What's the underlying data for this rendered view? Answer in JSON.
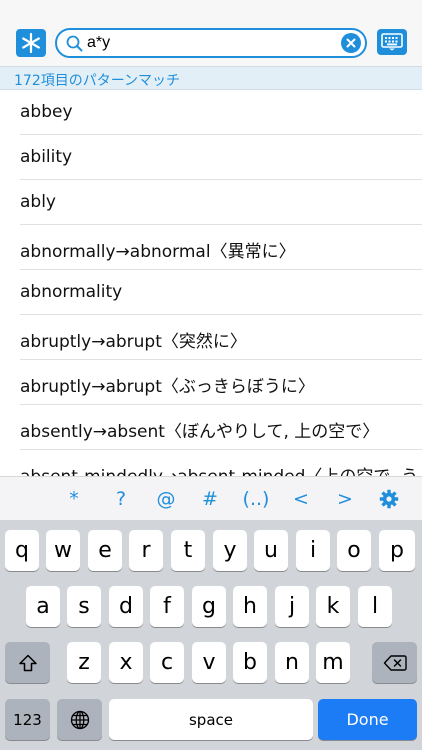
{
  "search": {
    "query": "a*y"
  },
  "match_count": "172項目のパターンマッチ",
  "results": [
    "abbey",
    "ability",
    "ably",
    "abnormally→abnormal〈異常に〉",
    "abnormality",
    "abruptly→abrupt〈突然に〉",
    "abruptly→abrupt〈ぶっきらぼうに〉",
    "absently→absent〈ぼんやりして, 上の空で〉",
    "absent-mindedly→absent-minded〈上の空で, う"
  ],
  "accessory_keys": [
    "*",
    "?",
    "@",
    "#",
    "(..)",
    "<",
    ">"
  ],
  "keyboard": {
    "row1": [
      "q",
      "w",
      "e",
      "r",
      "t",
      "y",
      "u",
      "i",
      "o",
      "p"
    ],
    "row2": [
      "a",
      "s",
      "d",
      "f",
      "g",
      "h",
      "j",
      "k",
      "l"
    ],
    "row3": [
      "z",
      "x",
      "c",
      "v",
      "b",
      "n",
      "m"
    ],
    "numbers_label": "123",
    "space_label": "space",
    "done_label": "Done"
  },
  "colors": {
    "accent": "#1f8fdc",
    "done_key": "#1b7cf6",
    "keyboard_bg": "#d1d4d9"
  }
}
